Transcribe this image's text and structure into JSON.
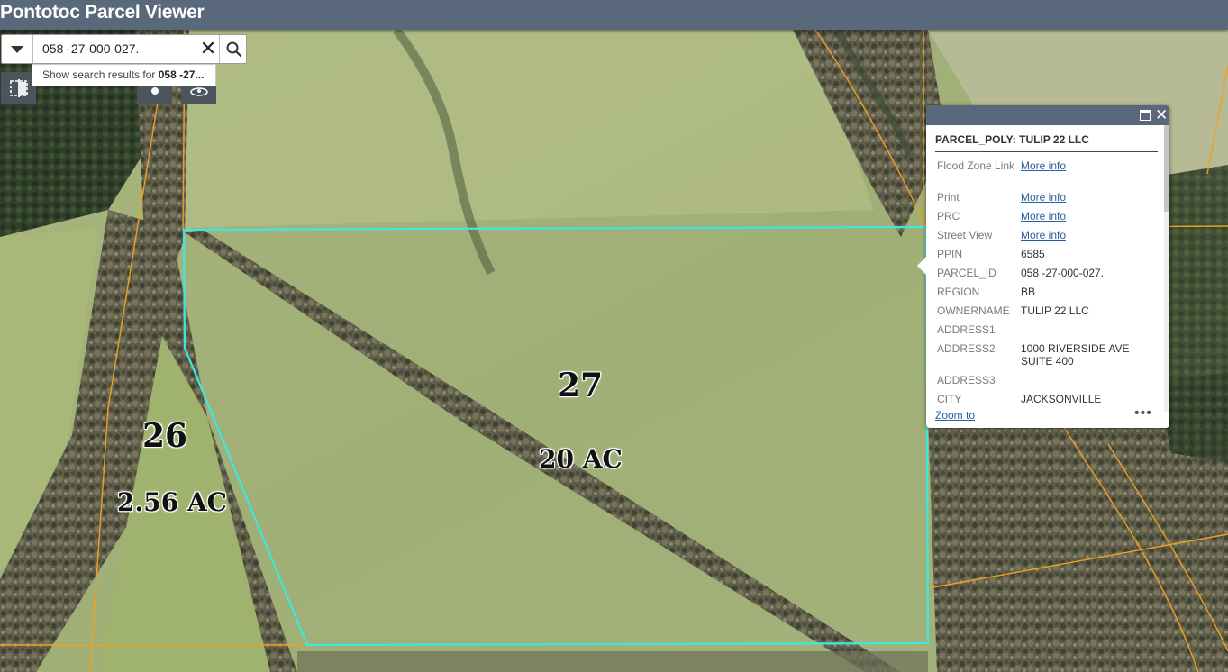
{
  "app": {
    "title": "Pontotoc Parcel Viewer"
  },
  "search": {
    "value": "058 -27-000-027.",
    "clear_icon": "close-icon",
    "search_icon": "search-icon",
    "suggestion_prefix": "Show search results for",
    "suggestion_term": "058 -27..."
  },
  "map": {
    "labels": {
      "parcel_26": "26",
      "parcel_26_area": "2.56 AC",
      "parcel_27": "27",
      "parcel_27_area": "20 AC"
    },
    "colors": {
      "selected_parcel": "#3ee8e0",
      "parcel_lines": "#f0a020"
    }
  },
  "popup": {
    "title": "PARCEL_POLY: TULIP 22 LLC",
    "rows": [
      {
        "key": "Flood Zone Link",
        "value": "More info",
        "link": true
      },
      {
        "key": "Print",
        "value": "More info",
        "link": true
      },
      {
        "key": "PRC",
        "value": "More info",
        "link": true
      },
      {
        "key": "Street View",
        "value": "More info",
        "link": true
      },
      {
        "key": "PPIN",
        "value": "6585",
        "link": false
      },
      {
        "key": "PARCEL_ID",
        "value": "058 -27-000-027.",
        "link": false
      },
      {
        "key": "REGION",
        "value": "BB",
        "link": false
      },
      {
        "key": "OWNERNAME",
        "value": "TULIP 22 LLC",
        "link": false
      },
      {
        "key": "ADDRESS1",
        "value": "",
        "link": false
      },
      {
        "key": "ADDRESS2",
        "value": "1000 RIVERSIDE AVE SUITE 400",
        "link": false
      },
      {
        "key": "ADDRESS3",
        "value": "",
        "link": false
      },
      {
        "key": "CITY",
        "value": "JACKSONVILLE",
        "link": false
      }
    ],
    "zoom_label": "Zoom to",
    "more_label": "•••"
  }
}
